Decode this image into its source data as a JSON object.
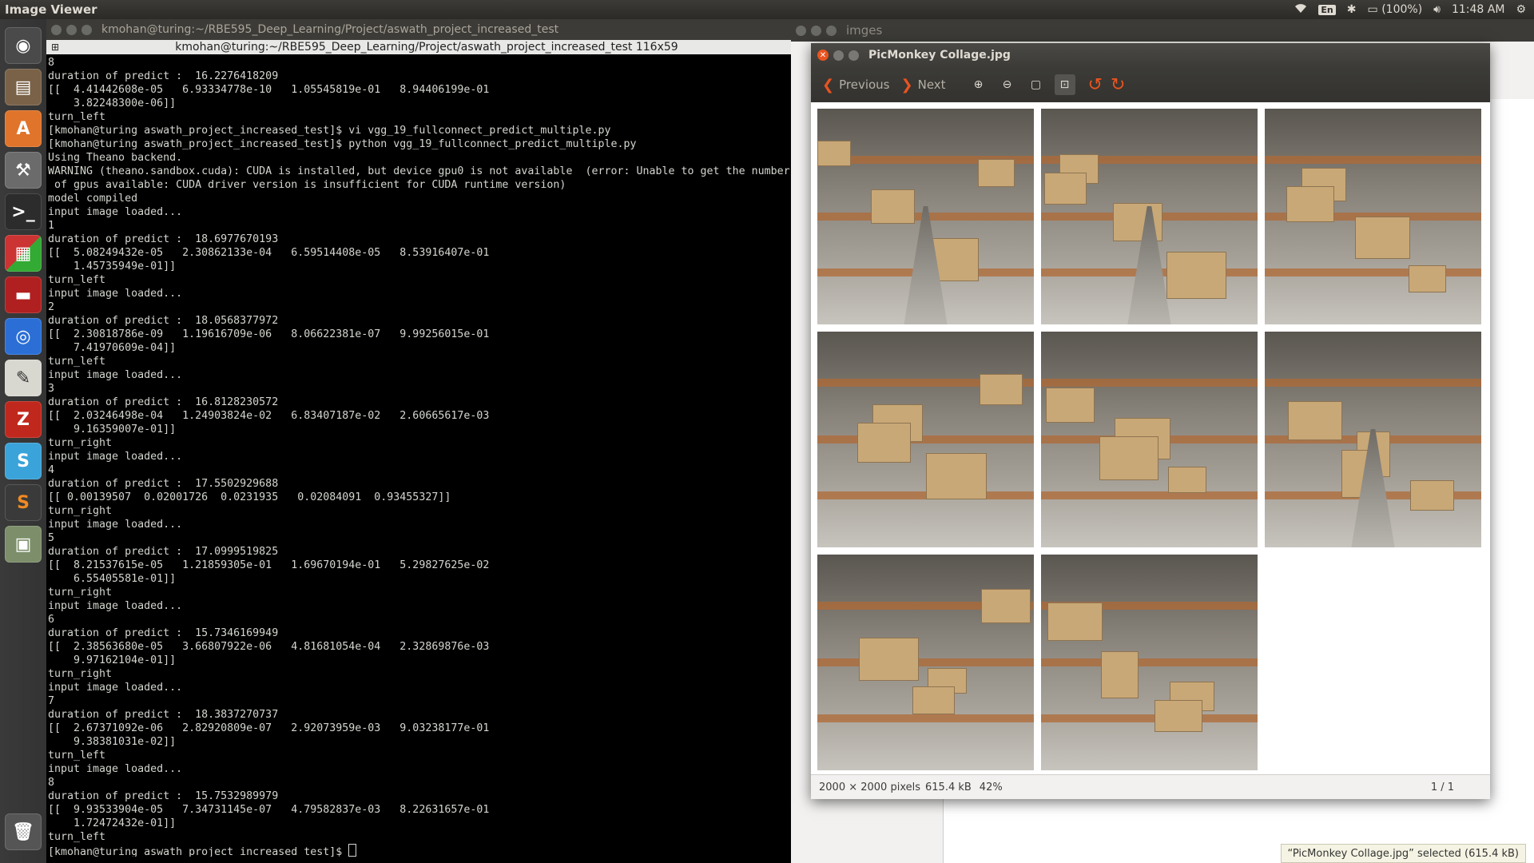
{
  "top_panel": {
    "app_title": "Image Viewer",
    "keyboard_layout": "En",
    "battery": "(100%)",
    "time": "11:48 AM"
  },
  "launcher": {
    "items": [
      {
        "name": "dash-home-icon"
      },
      {
        "name": "files-icon"
      },
      {
        "name": "software-center-icon"
      },
      {
        "name": "system-settings-icon"
      },
      {
        "name": "terminal-icon"
      },
      {
        "name": "workspace-switcher-icon"
      },
      {
        "name": "red-app-icon"
      },
      {
        "name": "chrome-icon"
      },
      {
        "name": "text-editor-icon"
      },
      {
        "name": "filezilla-icon"
      },
      {
        "name": "slack-icon"
      },
      {
        "name": "sublime-text-icon"
      },
      {
        "name": "image-viewer-icon"
      },
      {
        "name": "trash-icon"
      }
    ]
  },
  "terminal": {
    "window_title": "kmohan@turing:~/RBE595_Deep_Learning/Project/aswath_project_increased_test",
    "tab_title": "kmohan@turing:~/RBE595_Deep_Learning/Project/aswath_project_increased_test 116x59",
    "lines": [
      "8",
      "duration of predict :  16.2276418209",
      "[[  4.41442608e-05   6.93334778e-10   1.05545819e-01   8.94406199e-01",
      "    3.82248300e-06]]",
      "turn_left",
      "[kmohan@turing aswath_project_increased_test]$ vi vgg_19_fullconnect_predict_multiple.py",
      "[kmohan@turing aswath_project_increased_test]$ python vgg_19_fullconnect_predict_multiple.py",
      "Using Theano backend.",
      "WARNING (theano.sandbox.cuda): CUDA is installed, but device gpu0 is not available  (error: Unable to get the number",
      " of gpus available: CUDA driver version is insufficient for CUDA runtime version)",
      "model compiled",
      "input image loaded...",
      "1",
      "duration of predict :  18.6977670193",
      "[[  5.08249432e-05   2.30862133e-04   6.59514408e-05   8.53916407e-01",
      "    1.45735949e-01]]",
      "turn_left",
      "input image loaded...",
      "2",
      "duration of predict :  18.0568377972",
      "[[  2.30818786e-09   1.19616709e-06   8.06622381e-07   9.99256015e-01",
      "    7.41970609e-04]]",
      "turn_left",
      "input image loaded...",
      "3",
      "duration of predict :  16.8128230572",
      "[[  2.03246498e-04   1.24903824e-02   6.83407187e-02   2.60665617e-03",
      "    9.16359007e-01]]",
      "turn_right",
      "input image loaded...",
      "4",
      "duration of predict :  17.5502929688",
      "[[ 0.00139507  0.02001726  0.0231935   0.02084091  0.93455327]]",
      "turn_right",
      "input image loaded...",
      "5",
      "duration of predict :  17.0999519825",
      "[[  8.21537615e-05   1.21859305e-01   1.69670194e-01   5.29827625e-02",
      "    6.55405581e-01]]",
      "turn_right",
      "input image loaded...",
      "6",
      "duration of predict :  15.7346169949",
      "[[  2.38563680e-05   3.66807922e-06   4.81681054e-04   2.32869876e-03",
      "    9.97162104e-01]]",
      "turn_right",
      "input image loaded...",
      "7",
      "duration of predict :  18.3837270737",
      "[[  2.67371092e-06   2.82920809e-07   2.92073959e-03   9.03238177e-01",
      "    9.38381031e-02]]",
      "turn_left",
      "input image loaded...",
      "8",
      "duration of predict :  15.7532989979",
      "[[  9.93533904e-05   7.34731145e-07   4.79582837e-03   8.22631657e-01",
      "    1.72472432e-01]]",
      "turn_left"
    ],
    "prompt": "[kmohan@turing aswath_project_increased_test]$ "
  },
  "background_window": {
    "title": "imges"
  },
  "viewer": {
    "title": "PicMonkey Collage.jpg",
    "toolbar": {
      "previous_label": "Previous",
      "next_label": "Next"
    },
    "status": {
      "dimensions": "2000 × 2000 pixels",
      "size": "615.4 kB",
      "zoom": "42%",
      "position": "1 / 1"
    },
    "tiles": [
      {
        "name": "warehouse-aisle-1"
      },
      {
        "name": "warehouse-aisle-2"
      },
      {
        "name": "warehouse-blurred-3"
      },
      {
        "name": "warehouse-blurred-4"
      },
      {
        "name": "warehouse-shelves-5"
      },
      {
        "name": "warehouse-shelves-6"
      },
      {
        "name": "warehouse-pallets-7"
      },
      {
        "name": "warehouse-boxes-8"
      }
    ]
  },
  "nautilus_status": "“PicMonkey Collage.jpg” selected (615.4 kB)",
  "colors": {
    "accent": "#e95420",
    "panel": "#3c3b37",
    "terminal_bg": "#000000",
    "terminal_fg": "#d3d7cf"
  }
}
